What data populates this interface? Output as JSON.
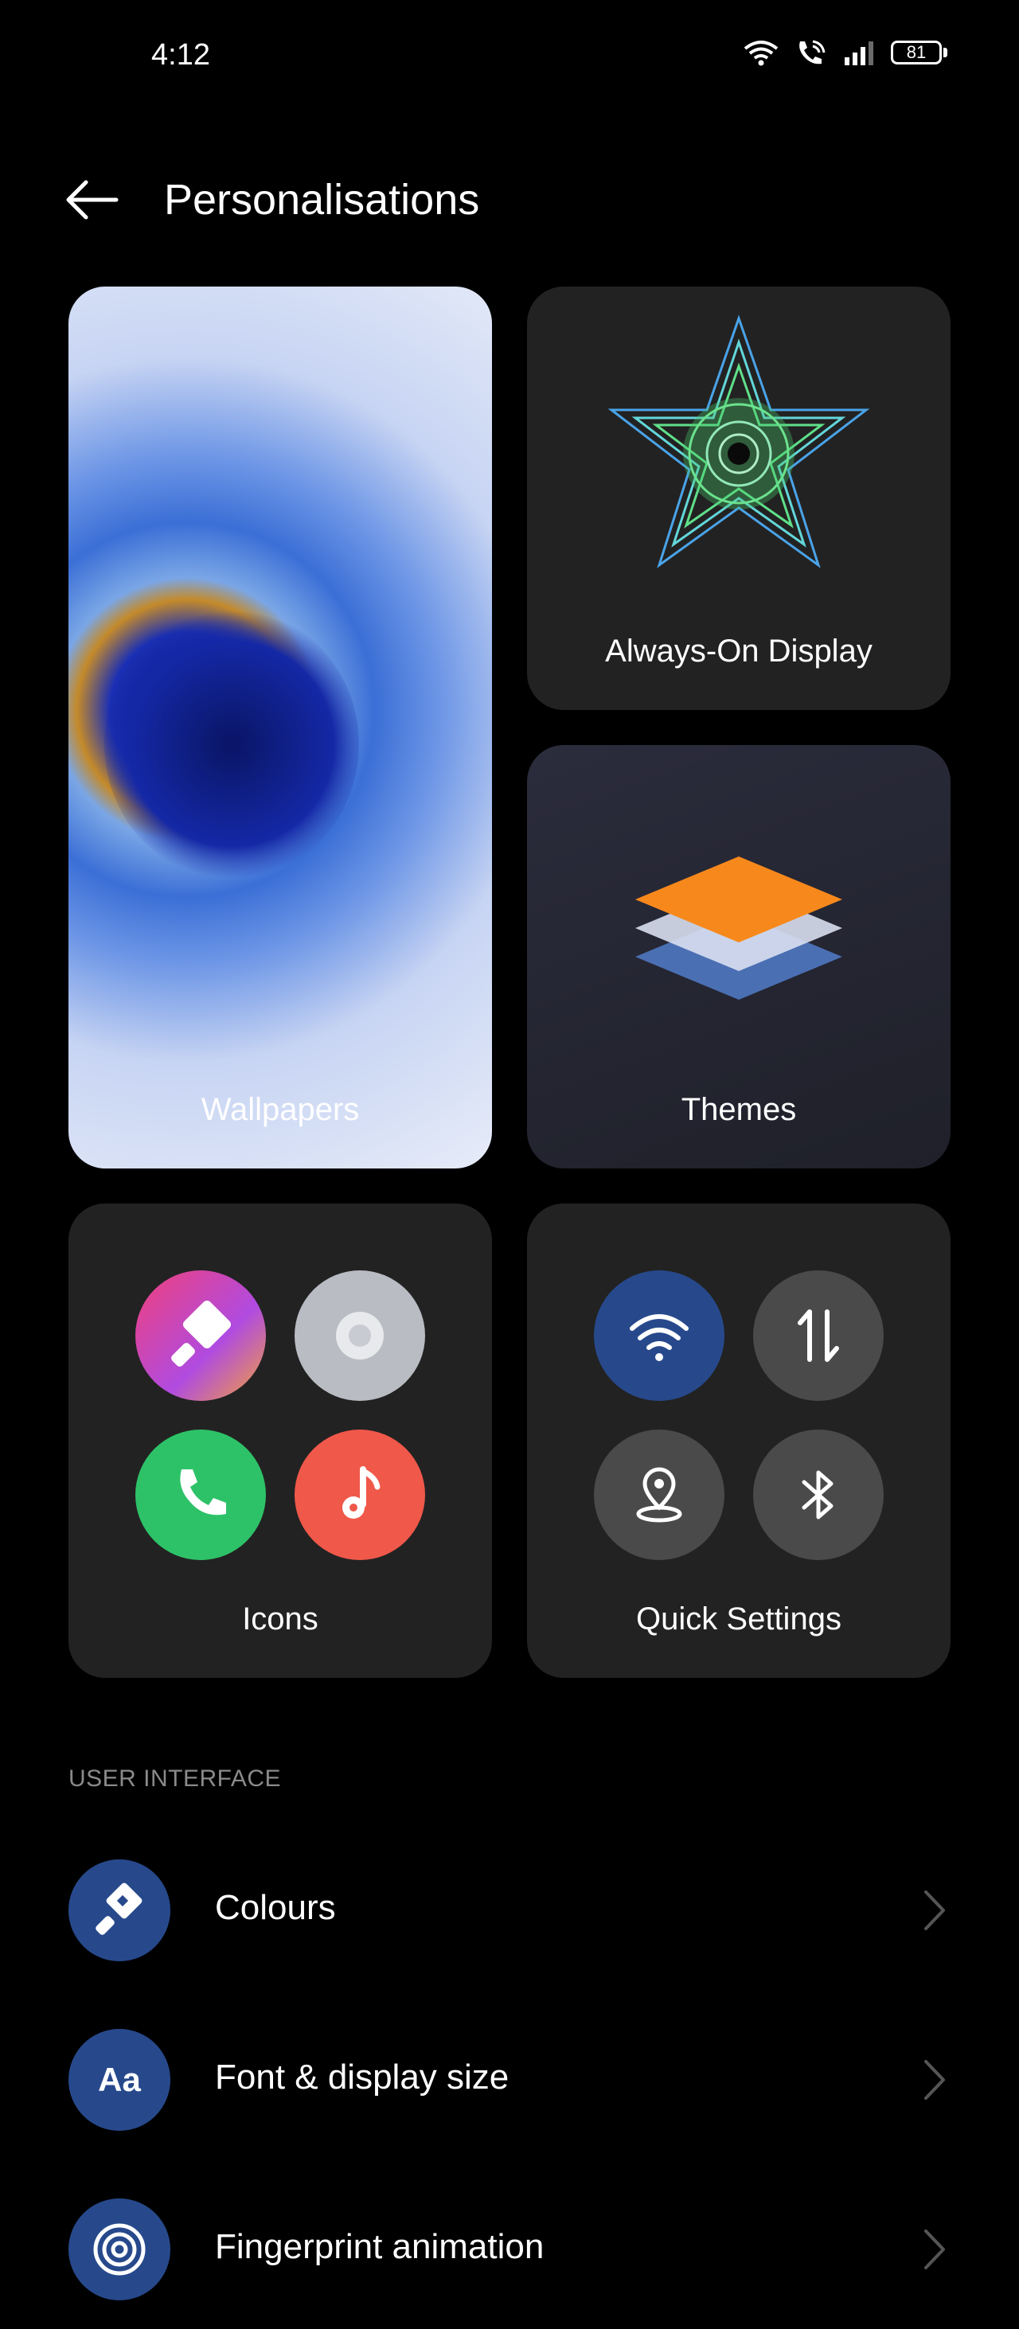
{
  "status_bar": {
    "time": "4:12",
    "battery": "81"
  },
  "header": {
    "title": "Personalisations"
  },
  "cards": {
    "wallpapers": "Wallpapers",
    "always_on_display": "Always-On Display",
    "themes": "Themes",
    "icons": "Icons",
    "quick_settings": "Quick Settings"
  },
  "section": {
    "user_interface": "USER INTERFACE"
  },
  "list": [
    {
      "label": "Colours",
      "icon": "brush-icon"
    },
    {
      "label": "Font & display size",
      "icon": "font-icon",
      "icon_text": "Aa"
    },
    {
      "label": "Fingerprint animation",
      "icon": "fingerprint-icon"
    }
  ],
  "colors": {
    "background": "#000000",
    "card": "#222222",
    "accent_blue": "#27498c",
    "section_text": "#8a8a8a"
  }
}
